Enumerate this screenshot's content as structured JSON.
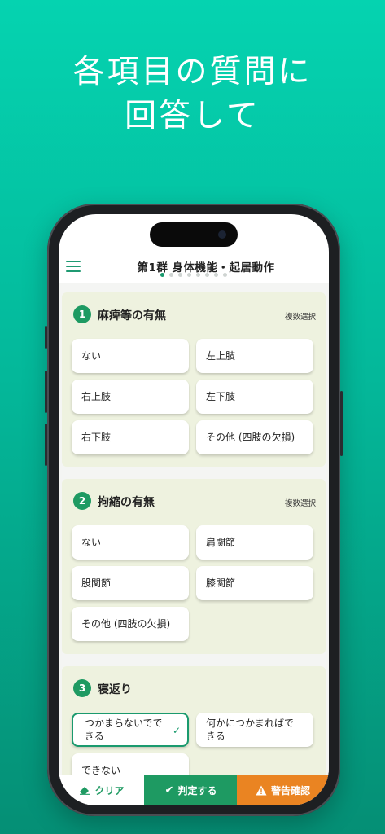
{
  "hero": {
    "line1": "各項目の質問に",
    "line2": "回答して"
  },
  "appbar": {
    "title": "第1群 身体機能・起居動作",
    "page_dots": 8,
    "active_dot": 0
  },
  "questions": [
    {
      "number": "1",
      "title": "麻痺等の有無",
      "note": "複数選択",
      "options": [
        "ない",
        "左上肢",
        "右上肢",
        "左下肢",
        "右下肢",
        "その他 (四肢の欠損)"
      ]
    },
    {
      "number": "2",
      "title": "拘縮の有無",
      "note": "複数選択",
      "options": [
        "ない",
        "肩関節",
        "股関節",
        "膝関節",
        "その他 (四肢の欠損)"
      ]
    },
    {
      "number": "3",
      "title": "寝返り",
      "options": [
        "つかまらないでできる",
        "何かにつかまればできる",
        "できない"
      ],
      "selected_option": 0
    }
  ],
  "bottom_bar": {
    "clear_label": "クリア",
    "judge_label": "判定する",
    "warn_label": "警告確認"
  },
  "colors": {
    "accent": "#1e9a62",
    "warning": "#ea8422",
    "card_bg": "#eef2df",
    "hero_bg": "#05d3b0"
  }
}
